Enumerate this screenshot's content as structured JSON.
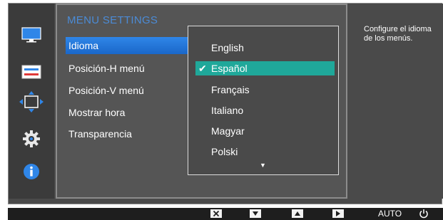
{
  "menu": {
    "title": "MENU SETTINGS",
    "items": [
      {
        "label": "Idioma",
        "selected": true
      },
      {
        "label": "Posición-H menú",
        "selected": false
      },
      {
        "label": "Posición-V menú",
        "selected": false
      },
      {
        "label": "Mostrar hora",
        "selected": false
      },
      {
        "label": "Transparencia",
        "selected": false
      }
    ]
  },
  "language_options": [
    {
      "label": "English",
      "selected": false
    },
    {
      "label": "Español",
      "selected": true
    },
    {
      "label": "Français",
      "selected": false
    },
    {
      "label": "Italiano",
      "selected": false
    },
    {
      "label": "Magyar",
      "selected": false
    },
    {
      "label": "Polski",
      "selected": false
    }
  ],
  "description": "Configure el idioma de los menús.",
  "sidebar_icons": [
    "monitor-icon",
    "picture-settings-icon",
    "position-move-icon",
    "gear-icon",
    "info-icon"
  ],
  "bottom_bar": {
    "keys": [
      "close-icon",
      "down-triangle-icon",
      "up-triangle-icon",
      "right-triangle-icon"
    ],
    "auto_label": "AUTO",
    "power_icon": "power-icon"
  },
  "colors": {
    "accent_blue": "#2f86e8",
    "title_blue": "#4b8bd6",
    "selection_teal": "#1fa89a"
  }
}
